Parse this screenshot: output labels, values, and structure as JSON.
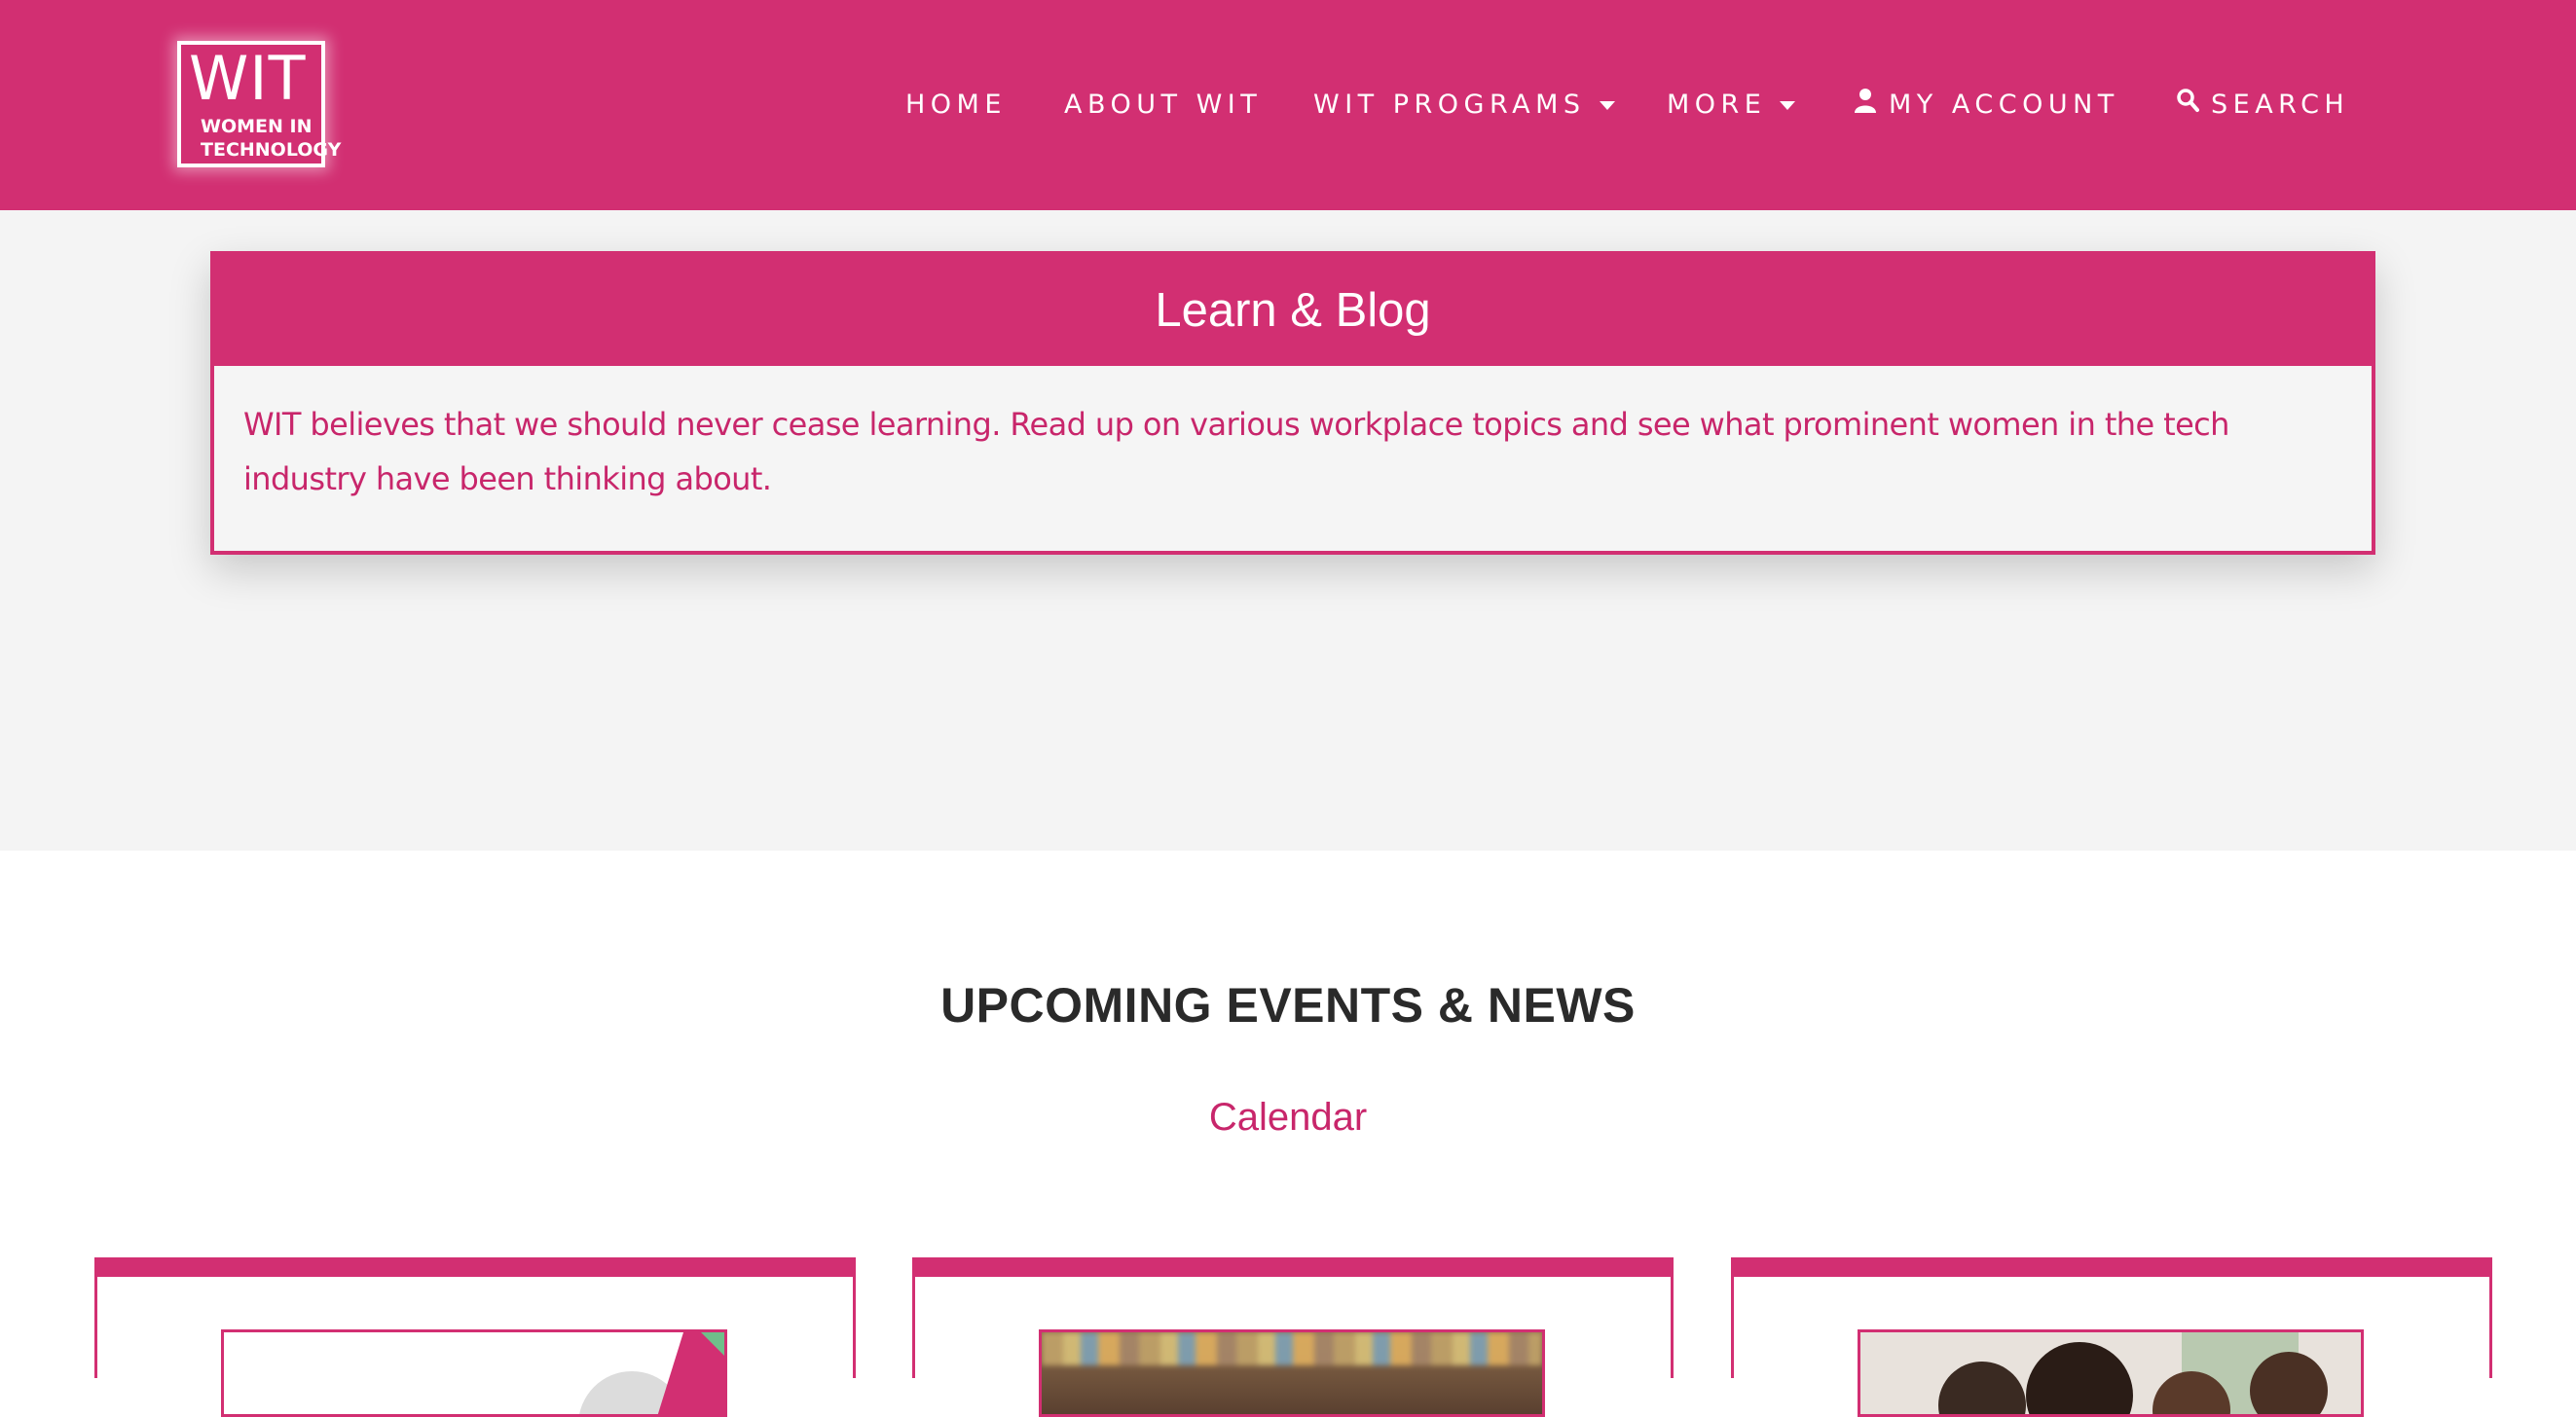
{
  "header": {
    "logo": {
      "title": "WIT",
      "subtitle_line1": "WOMEN IN",
      "subtitle_line2": "TECHNOLOGY"
    },
    "nav": {
      "home": "HOME",
      "about": "ABOUT WIT",
      "programs": "WIT PROGRAMS",
      "more": "MORE",
      "account": "MY ACCOUNT",
      "search": "SEARCH"
    }
  },
  "hero": {
    "title": "Learn & Blog",
    "description": "WIT believes that we should never cease learning. Read up on various workplace topics and see what prominent women in the tech industry have been thinking about."
  },
  "events": {
    "title": "UPCOMING EVENTS & NEWS",
    "calendar_link": "Calendar"
  },
  "colors": {
    "brand_pink": "#d22f72",
    "text_pink": "#c8266b",
    "hero_bg": "#f4f4f4"
  },
  "icons": {
    "account": "user-icon",
    "search": "search-icon",
    "dropdown": "caret-down-icon"
  }
}
